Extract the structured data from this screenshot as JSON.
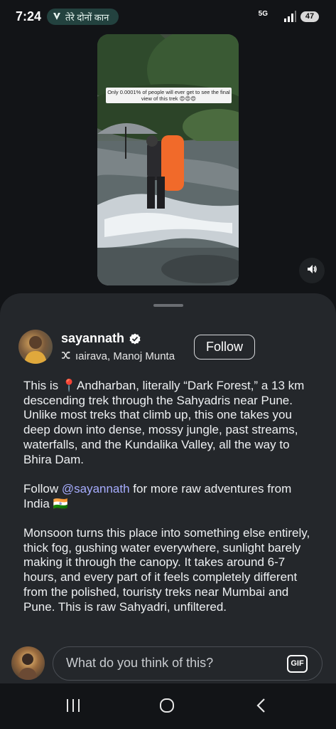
{
  "status_bar": {
    "time": "7:24",
    "now_playing": "तेरे दोनों कान",
    "network": "5G",
    "battery": "47"
  },
  "video": {
    "caption": "Only 0.0001% of people will ever get to see the final view of this trek 😍😍😍",
    "sound_icon": "speaker-icon"
  },
  "post": {
    "username": "sayannath",
    "audio": "ıairava, Manoj Munta",
    "follow_label": "Follow",
    "paragraph1": "This is 📍Andharban, literally “Dark Forest,” a 13 km descending trek through the Sahyadris near Pune. Unlike most treks that climb up, this one takes you deep down into dense, mossy jungle, past streams, waterfalls, and the Kundalika Valley, all the way to Bhira Dam.",
    "p2_before": "Follow ",
    "p2_mention": "@sayannath",
    "p2_after": " for more raw adventures from India 🇮🇳",
    "paragraph3": "Monsoon turns this place into something else entirely, thick fog, gushing water everywhere, sunlight barely making it through the canopy. It takes around 6-7 hours, and every part of it feels completely different from the polished, touristy treks near Mumbai and Pune. This is raw Sahyadri, unfiltered."
  },
  "comment": {
    "placeholder": "What do you think of this?",
    "gif_label": "GIF"
  },
  "colors": {
    "background": "#121417",
    "sheet": "#24272b",
    "mention": "#a7adff",
    "verified": "#ffffff"
  }
}
